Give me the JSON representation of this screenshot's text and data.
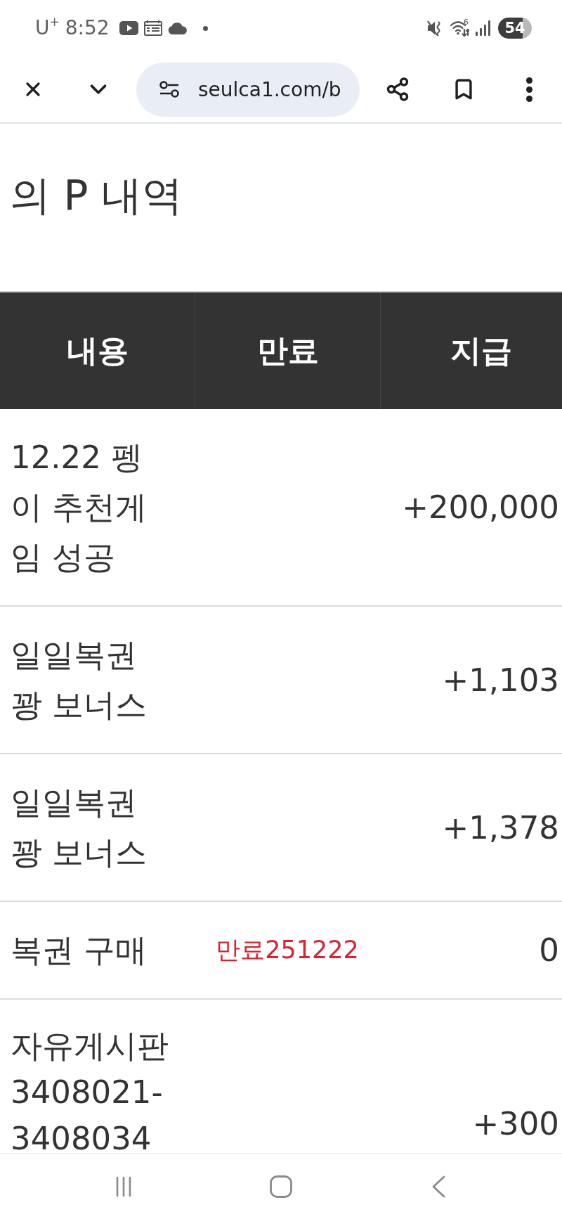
{
  "status_bar": {
    "carrier": "U$^{+}$",
    "time": "8:52",
    "wifi_label": "6",
    "battery": "54"
  },
  "browser_toolbar": {
    "url": "seulca1.com/b"
  },
  "page": {
    "title": "의 P 내역"
  },
  "table": {
    "columns": [
      "내용",
      "만료",
      "지급"
    ],
    "rows": [
      {
        "content": "12.22 펭이 추천게임 성공",
        "amount": "+200,000"
      },
      {
        "content": "일일복권 꽝 보너스",
        "amount": "+1,103"
      },
      {
        "content": "일일복권 꽝 보너스",
        "amount": "+1,378"
      },
      {
        "content": "복권 구매",
        "expiry": "만료251222",
        "amount": "0"
      },
      {
        "content": "자유게시판 3408021-3408034",
        "amount": "+300"
      }
    ]
  }
}
